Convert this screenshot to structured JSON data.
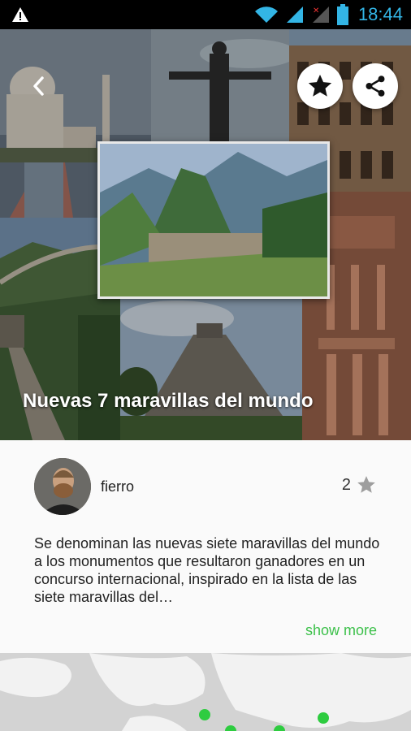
{
  "status_bar": {
    "time": "18:44",
    "icons": [
      "warning-icon",
      "wifi-icon",
      "signal-icon",
      "no-signal-icon",
      "battery-icon"
    ]
  },
  "hero": {
    "title": "Nuevas 7 maravillas del mundo",
    "buttons": {
      "back": "chevron-left-icon",
      "favorite": "star-icon",
      "share": "share-icon"
    }
  },
  "post": {
    "author": "fierro",
    "stars_count": "2",
    "description": "Se denominan las nuevas siete maravillas del mundo a los monumentos que resultaron ganadores en un concurso internacional, inspirado en la lista de las siete maravillas del…",
    "show_more": "show more"
  },
  "colors": {
    "accent_green": "#3cc04a",
    "status_time_blue": "#33b5e5",
    "map_dot_green": "#2ecc40"
  }
}
